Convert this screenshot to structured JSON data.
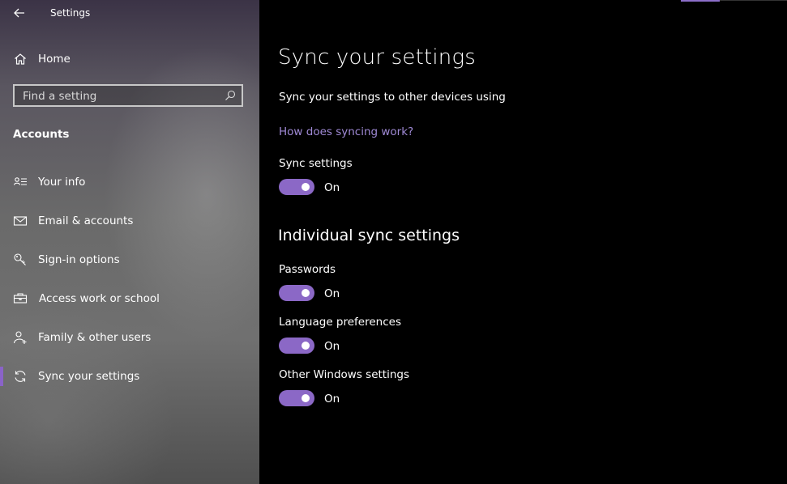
{
  "window": {
    "title": "Settings"
  },
  "sidebar": {
    "home_label": "Home",
    "search": {
      "placeholder": "Find a setting",
      "value": ""
    },
    "section_title": "Accounts",
    "items": [
      {
        "label": "Your info",
        "icon": "contact-card-icon"
      },
      {
        "label": "Email & accounts",
        "icon": "mail-icon"
      },
      {
        "label": "Sign-in options",
        "icon": "key-icon"
      },
      {
        "label": "Access work or school",
        "icon": "briefcase-icon"
      },
      {
        "label": "Family & other users",
        "icon": "person-add-icon"
      },
      {
        "label": "Sync your settings",
        "icon": "sync-icon",
        "selected": true
      }
    ]
  },
  "main": {
    "title": "Sync your settings",
    "description": "Sync your settings to other devices using",
    "link": "How does syncing work?",
    "sync_settings": {
      "label": "Sync settings",
      "state": "On"
    },
    "individual_heading": "Individual sync settings",
    "individual": [
      {
        "label": "Passwords",
        "state": "On"
      },
      {
        "label": "Language preferences",
        "state": "On"
      },
      {
        "label": "Other Windows settings",
        "state": "On"
      }
    ]
  },
  "colors": {
    "accent": "#8b68c6",
    "link": "#a08ad6",
    "background": "#000000"
  }
}
